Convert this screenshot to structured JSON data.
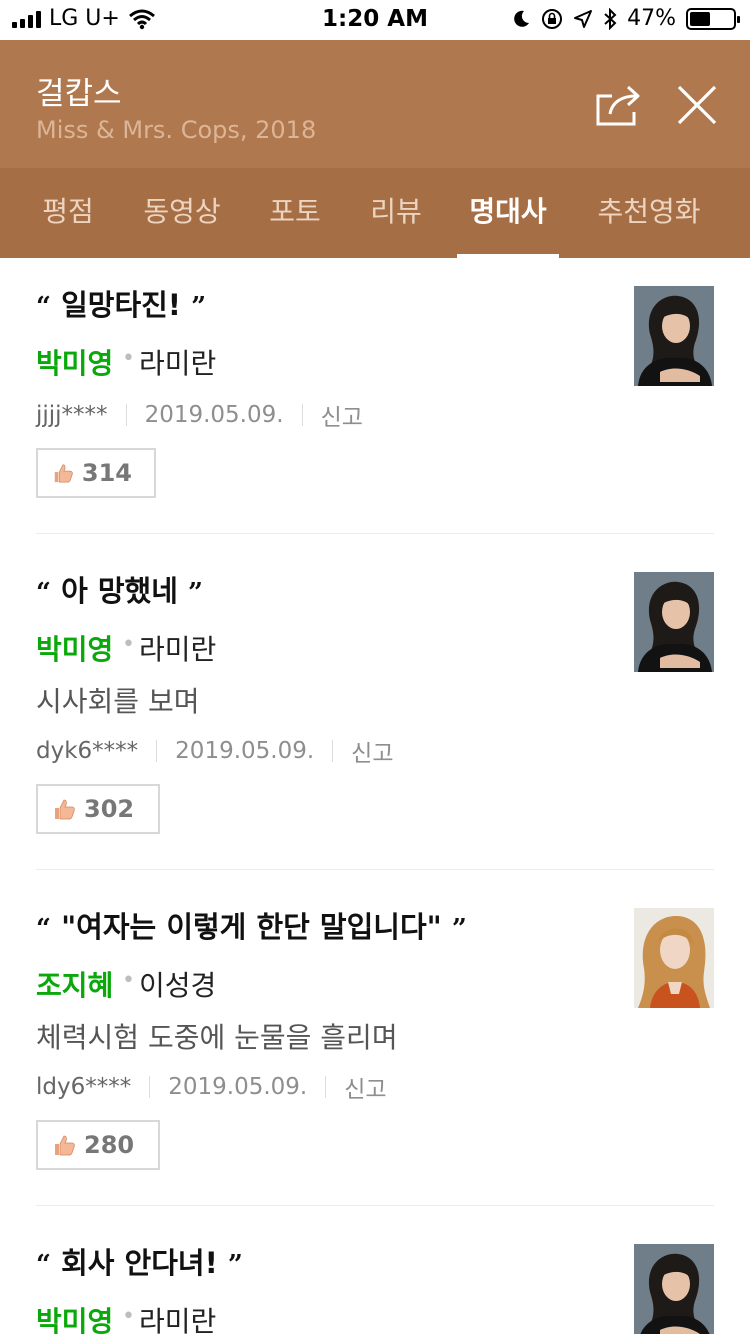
{
  "status_bar": {
    "carrier": "LG U+",
    "time": "1:20 AM",
    "battery_pct": "47%",
    "battery_level": 0.47,
    "icons": [
      "signal-icon",
      "wifi-icon",
      "moon-icon",
      "rotation-lock-icon",
      "location-icon",
      "bluetooth-icon",
      "battery-icon"
    ]
  },
  "header": {
    "title": "걸캅스",
    "subtitle": "Miss & Mrs. Cops, 2018",
    "background": "#b0784e",
    "share_icon": "share-icon",
    "close_icon": "close-icon"
  },
  "tabs": [
    {
      "label": "평점",
      "active": false
    },
    {
      "label": "동영상",
      "active": false
    },
    {
      "label": "포토",
      "active": false
    },
    {
      "label": "리뷰",
      "active": false
    },
    {
      "label": "명대사",
      "active": true
    },
    {
      "label": "추천영화",
      "active": false
    }
  ],
  "lines": [
    {
      "open_quote": "“",
      "quote": "일망타진!",
      "close_quote": "”",
      "actor": "박미영",
      "dot": "•",
      "role": "라미란",
      "scene": "",
      "user": "jjjj****",
      "date": "2019.05.09.",
      "report": "신고",
      "likes": "314",
      "photo": "actor-photo-dark-hair"
    },
    {
      "open_quote": "“",
      "quote": "아 망했네",
      "close_quote": "”",
      "actor": "박미영",
      "dot": "•",
      "role": "라미란",
      "scene": "시사회를 보며",
      "user": "dyk6****",
      "date": "2019.05.09.",
      "report": "신고",
      "likes": "302",
      "photo": "actor-photo-dark-hair"
    },
    {
      "open_quote": "“",
      "quote": "\"여자는 이렇게 한단 말입니다\"",
      "close_quote": "”",
      "actor": "조지혜",
      "dot": "•",
      "role": "이성경",
      "scene": "체력시험 도중에 눈물을 흘리며",
      "user": "ldy6****",
      "date": "2019.05.09.",
      "report": "신고",
      "likes": "280",
      "photo": "actor-photo-blonde-hair"
    },
    {
      "open_quote": "“",
      "quote": "회사 안다녀!",
      "close_quote": "”",
      "actor": "박미영",
      "dot": "•",
      "role": "라미란",
      "scene": "",
      "user": "",
      "date": "",
      "report": "",
      "likes": "",
      "photo": "actor-photo-dark-hair"
    }
  ],
  "colors": {
    "actor_green": "#0aa80a",
    "tab_bar": "#a66e44"
  }
}
